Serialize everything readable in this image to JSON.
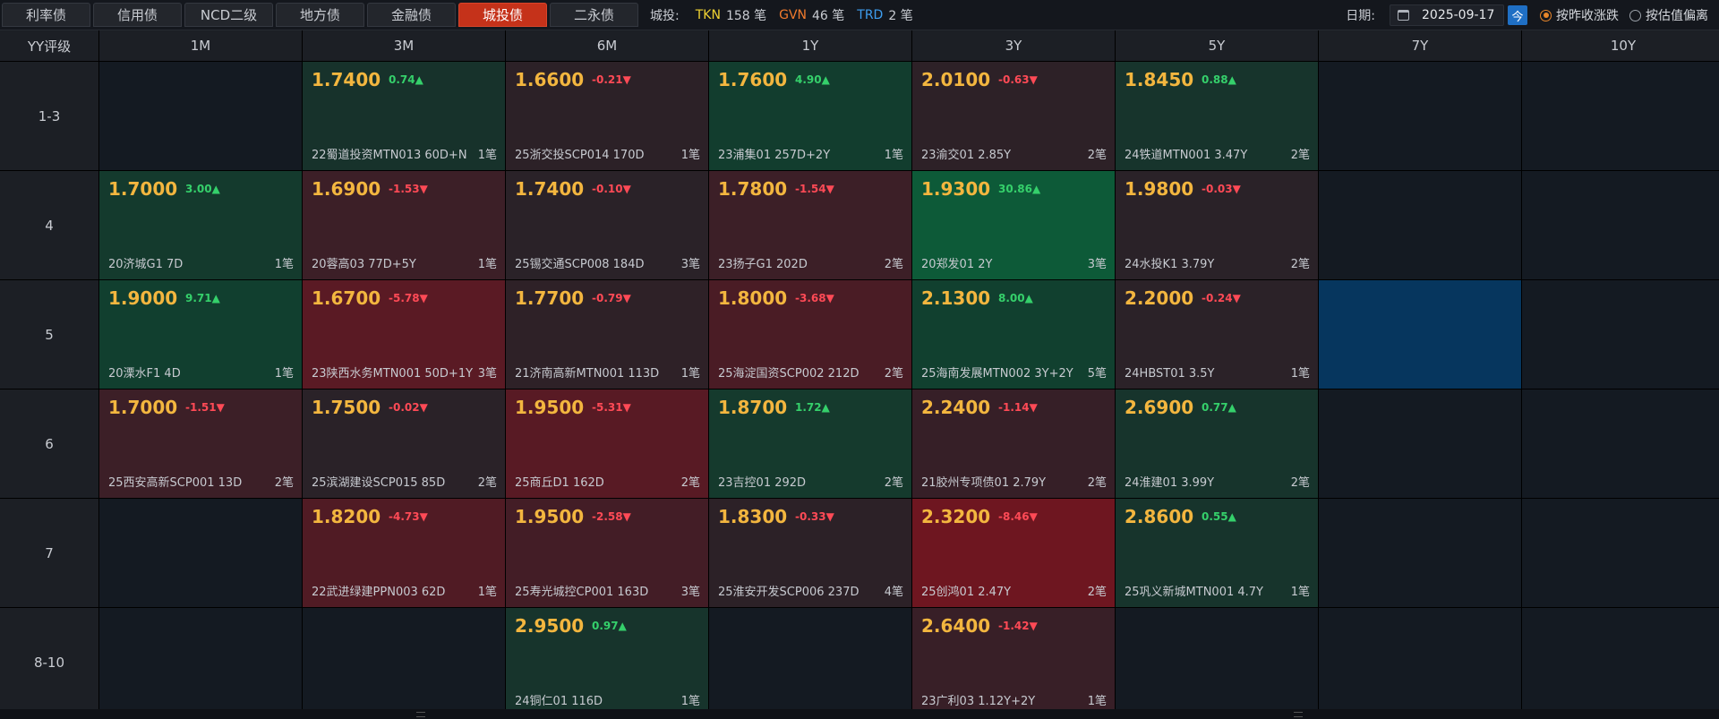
{
  "tabs": [
    {
      "label": "利率债",
      "active": false
    },
    {
      "label": "信用债",
      "active": false
    },
    {
      "label": "NCD二级",
      "active": false
    },
    {
      "label": "地方债",
      "active": false
    },
    {
      "label": "金融债",
      "active": false
    },
    {
      "label": "城投债",
      "active": true
    },
    {
      "label": "二永债",
      "active": false
    }
  ],
  "counts": {
    "label": "城投:",
    "items": [
      {
        "key": "TKN",
        "value": "158 笔",
        "color": "#f0d332"
      },
      {
        "key": "GVN",
        "value": "46 笔",
        "color": "#f07a2c"
      },
      {
        "key": "TRD",
        "value": "2 笔",
        "color": "#3e9ef0"
      }
    ]
  },
  "date": {
    "label": "日期:",
    "value": "2025-09-17",
    "today_label": "今"
  },
  "radios": [
    {
      "label": "按昨收涨跌",
      "checked": true
    },
    {
      "label": "按估值偏离",
      "checked": false
    }
  ],
  "grid": {
    "corner": "YY评级",
    "columns": [
      "1M",
      "3M",
      "6M",
      "1Y",
      "3Y",
      "5Y",
      "7Y",
      "10Y"
    ],
    "rows": [
      {
        "label": "1-3",
        "cells": [
          null,
          {
            "rate": "1.7400",
            "change": "0.74▲",
            "dir": "up",
            "bond": "22蜀道投资MTN013 60D+N",
            "trades": "1笔",
            "bg": "#17322b"
          },
          {
            "rate": "1.6600",
            "change": "-0.21▼",
            "dir": "down",
            "bond": "25浙交投SCP014 170D",
            "trades": "1笔",
            "bg": "#2c2127"
          },
          {
            "rate": "1.7600",
            "change": "4.90▲",
            "dir": "up",
            "bond": "23浦集01 257D+2Y",
            "trades": "1笔",
            "bg": "#123d2e"
          },
          {
            "rate": "2.0100",
            "change": "-0.63▼",
            "dir": "down",
            "bond": "23渝交01 2.85Y",
            "trades": "2笔",
            "bg": "#2d2127"
          },
          {
            "rate": "1.8450",
            "change": "0.88▲",
            "dir": "up",
            "bond": "24铁道MTN001 3.47Y",
            "trades": "2笔",
            "bg": "#17342c"
          },
          null,
          null
        ]
      },
      {
        "label": "4",
        "cells": [
          {
            "rate": "1.7000",
            "change": "3.00▲",
            "dir": "up",
            "bond": "20济城G1 7D",
            "trades": "1笔",
            "bg": "#143a2d"
          },
          {
            "rate": "1.6900",
            "change": "-1.53▼",
            "dir": "down",
            "bond": "20蓉高03 77D+5Y",
            "trades": "1笔",
            "bg": "#3c1f27"
          },
          {
            "rate": "1.7400",
            "change": "-0.10▼",
            "dir": "down",
            "bond": "25锡交通SCP008 184D",
            "trades": "3笔",
            "bg": "#2a2228"
          },
          {
            "rate": "1.7800",
            "change": "-1.54▼",
            "dir": "down",
            "bond": "23扬子G1 202D",
            "trades": "2笔",
            "bg": "#3c1f27"
          },
          {
            "rate": "1.9300",
            "change": "30.86▲",
            "dir": "up",
            "bond": "20郑发01 2Y",
            "trades": "3笔",
            "bg": "#0d5a38"
          },
          {
            "rate": "1.9800",
            "change": "-0.03▼",
            "dir": "down",
            "bond": "24水投K1 3.79Y",
            "trades": "2笔",
            "bg": "#2a2228"
          },
          null,
          null
        ]
      },
      {
        "label": "5",
        "cells": [
          {
            "rate": "1.9000",
            "change": "9.71▲",
            "dir": "up",
            "bond": "20溧水F1 4D",
            "trades": "1笔",
            "bg": "#113f2f"
          },
          {
            "rate": "1.6700",
            "change": "-5.78▼",
            "dir": "down",
            "bond": "23陕西水务MTN001 50D+1Y",
            "trades": "3笔",
            "bg": "#5a1a24"
          },
          {
            "rate": "1.7700",
            "change": "-0.79▼",
            "dir": "down",
            "bond": "21济南高新MTN001 113D",
            "trades": "1笔",
            "bg": "#2e2127"
          },
          {
            "rate": "1.8000",
            "change": "-3.68▼",
            "dir": "down",
            "bond": "25海淀国资SCP002 212D",
            "trades": "2笔",
            "bg": "#4a1c25"
          },
          {
            "rate": "2.1300",
            "change": "8.00▲",
            "dir": "up",
            "bond": "25海南发展MTN002 3Y+2Y",
            "trades": "5笔",
            "bg": "#11402f"
          },
          {
            "rate": "2.2000",
            "change": "-0.24▼",
            "dir": "down",
            "bond": "24HBST01 3.5Y",
            "trades": "1笔",
            "bg": "#2b2228"
          },
          "highlight",
          null
        ]
      },
      {
        "label": "6",
        "cells": [
          {
            "rate": "1.7000",
            "change": "-1.51▼",
            "dir": "down",
            "bond": "25西安高新SCP001 13D",
            "trades": "2笔",
            "bg": "#3c1f27"
          },
          {
            "rate": "1.7500",
            "change": "-0.02▼",
            "dir": "down",
            "bond": "25滨湖建设SCP015 85D",
            "trades": "2笔",
            "bg": "#2a2228"
          },
          {
            "rate": "1.9500",
            "change": "-5.31▼",
            "dir": "down",
            "bond": "25商丘D1 162D",
            "trades": "2笔",
            "bg": "#581a24"
          },
          {
            "rate": "1.8700",
            "change": "1.72▲",
            "dir": "up",
            "bond": "23吉控01 292D",
            "trades": "2笔",
            "bg": "#153a2d"
          },
          {
            "rate": "2.2400",
            "change": "-1.14▼",
            "dir": "down",
            "bond": "21胶州专项债01 2.79Y",
            "trades": "2笔",
            "bg": "#361f27"
          },
          {
            "rate": "2.6900",
            "change": "0.77▲",
            "dir": "up",
            "bond": "24淮建01 3.99Y",
            "trades": "2笔",
            "bg": "#17342c"
          },
          null,
          null
        ]
      },
      {
        "label": "7",
        "cells": [
          null,
          {
            "rate": "1.8200",
            "change": "-4.73▼",
            "dir": "down",
            "bond": "22武进绿建PPN003 62D",
            "trades": "1笔",
            "bg": "#501b24"
          },
          {
            "rate": "1.9500",
            "change": "-2.58▼",
            "dir": "down",
            "bond": "25寿光城控CP001 163D",
            "trades": "3笔",
            "bg": "#431d26"
          },
          {
            "rate": "1.8300",
            "change": "-0.33▼",
            "dir": "down",
            "bond": "25淮安开发SCP006 237D",
            "trades": "4笔",
            "bg": "#2c2127"
          },
          {
            "rate": "2.3200",
            "change": "-8.46▼",
            "dir": "down",
            "bond": "25创鸿01 2.47Y",
            "trades": "2笔",
            "bg": "#6e1620"
          },
          {
            "rate": "2.8600",
            "change": "0.55▲",
            "dir": "up",
            "bond": "25巩义新城MTN001 4.7Y",
            "trades": "1笔",
            "bg": "#17342c"
          },
          null,
          null
        ]
      },
      {
        "label": "8-10",
        "cells": [
          null,
          null,
          {
            "rate": "2.9500",
            "change": "0.97▲",
            "dir": "up",
            "bond": "24铜仁01 116D",
            "trades": "1笔",
            "bg": "#17342c"
          },
          null,
          {
            "rate": "2.6400",
            "change": "-1.42▼",
            "dir": "down",
            "bond": "23广利03 1.12Y+2Y",
            "trades": "1笔",
            "bg": "#381f27"
          },
          null,
          null,
          null
        ]
      }
    ]
  }
}
